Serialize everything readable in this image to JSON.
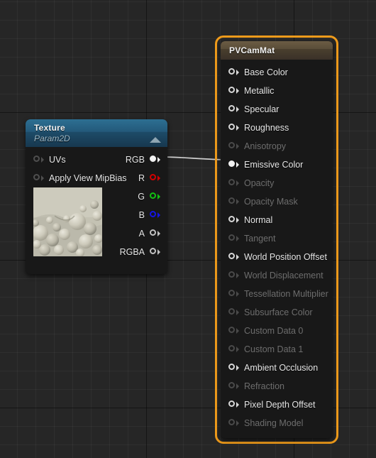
{
  "editor": {
    "name": "material-graph-editor",
    "background_color": "#262626",
    "grid_line_color": "#2f2f2f",
    "selection_color": "#ef9b1b",
    "wire_color": "#cfcfcf"
  },
  "nodes": {
    "material": {
      "title": "PVCamMat",
      "selected": true,
      "header_color": "#5a4d39",
      "pins": [
        {
          "label": "Base Color",
          "state": "enabled",
          "connected": false,
          "color": "white"
        },
        {
          "label": "Metallic",
          "state": "enabled",
          "connected": false,
          "color": "white"
        },
        {
          "label": "Specular",
          "state": "enabled",
          "connected": false,
          "color": "white"
        },
        {
          "label": "Roughness",
          "state": "enabled",
          "connected": false,
          "color": "white"
        },
        {
          "label": "Anisotropy",
          "state": "disabled",
          "connected": false,
          "color": "dim"
        },
        {
          "label": "Emissive Color",
          "state": "enabled",
          "connected": true,
          "color": "white"
        },
        {
          "label": "Opacity",
          "state": "disabled",
          "connected": false,
          "color": "dim"
        },
        {
          "label": "Opacity Mask",
          "state": "disabled",
          "connected": false,
          "color": "dim"
        },
        {
          "label": "Normal",
          "state": "enabled",
          "connected": false,
          "color": "white"
        },
        {
          "label": "Tangent",
          "state": "disabled",
          "connected": false,
          "color": "dim"
        },
        {
          "label": "World Position Offset",
          "state": "enabled",
          "connected": false,
          "color": "white"
        },
        {
          "label": "World Displacement",
          "state": "disabled",
          "connected": false,
          "color": "dim"
        },
        {
          "label": "Tessellation Multiplier",
          "state": "disabled",
          "connected": false,
          "color": "dim"
        },
        {
          "label": "Subsurface Color",
          "state": "disabled",
          "connected": false,
          "color": "dim"
        },
        {
          "label": "Custom Data 0",
          "state": "disabled",
          "connected": false,
          "color": "dim"
        },
        {
          "label": "Custom Data 1",
          "state": "disabled",
          "connected": false,
          "color": "dim"
        },
        {
          "label": "Ambient Occlusion",
          "state": "enabled",
          "connected": false,
          "color": "white"
        },
        {
          "label": "Refraction",
          "state": "disabled",
          "connected": false,
          "color": "dim"
        },
        {
          "label": "Pixel Depth Offset",
          "state": "enabled",
          "connected": false,
          "color": "white"
        },
        {
          "label": "Shading Model",
          "state": "disabled",
          "connected": false,
          "color": "dim"
        }
      ]
    },
    "texture": {
      "title": "Texture",
      "subtitle": "Param2D",
      "selected": false,
      "header_color": "#23597a",
      "collapse_icon": "collapse-triangle-icon",
      "inputs": [
        {
          "label": "UVs",
          "color": "input"
        },
        {
          "label": "Apply View MipBias",
          "color": "input"
        }
      ],
      "outputs": [
        {
          "label": "RGB",
          "color": "white",
          "connected": true
        },
        {
          "label": "R",
          "color": "red",
          "connected": false
        },
        {
          "label": "G",
          "color": "green",
          "connected": false
        },
        {
          "label": "B",
          "color": "blue",
          "connected": false
        },
        {
          "label": "A",
          "color": "gray",
          "connected": false
        },
        {
          "label": "RGBA",
          "color": "gray",
          "connected": false
        }
      ],
      "thumbnail": {
        "name": "texture-preview-thumbnail",
        "description": "bubble foam texture",
        "base_color": "#c3c1b2"
      }
    }
  },
  "connections": [
    {
      "from": "texture.RGB",
      "to": "material.Emissive Color",
      "color": "#cfcfcf"
    }
  ]
}
